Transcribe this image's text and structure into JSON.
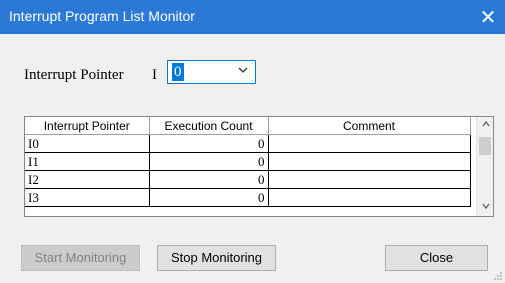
{
  "window": {
    "title": "Interrupt Program List Monitor",
    "close_glyph": "✕"
  },
  "pointer_selector": {
    "label": "Interrupt Pointer",
    "prefix": "I",
    "value": "0",
    "chevron_icon": "chevron-down-icon"
  },
  "table": {
    "columns": [
      "Interrupt Pointer",
      "Execution Count",
      "Comment"
    ],
    "rows": [
      {
        "pointer": "I0",
        "count": "0",
        "comment": ""
      },
      {
        "pointer": "I1",
        "count": "0",
        "comment": ""
      },
      {
        "pointer": "I2",
        "count": "0",
        "comment": ""
      },
      {
        "pointer": "I3",
        "count": "0",
        "comment": ""
      }
    ]
  },
  "buttons": {
    "start_label": "Start Monitoring",
    "stop_label": "Stop Monitoring",
    "close_label": "Close"
  },
  "colors": {
    "titlebar": "#2b79d6",
    "selection": "#0078d7",
    "window_bg": "#f0f0f0"
  }
}
